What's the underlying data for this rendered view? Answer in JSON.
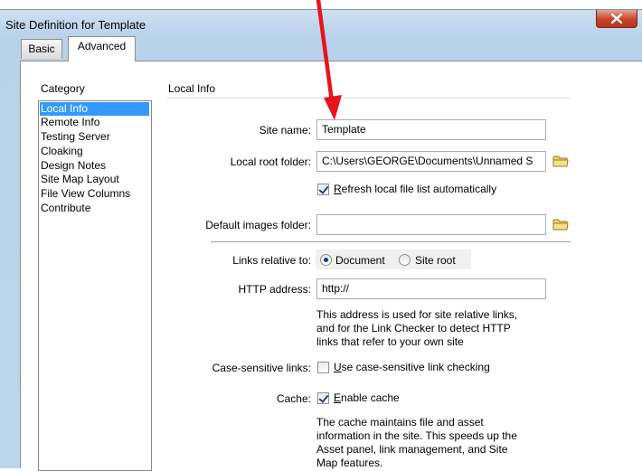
{
  "window": {
    "title": "Site Definition for Template",
    "close_label": "X"
  },
  "tabs": [
    {
      "label": "Basic",
      "active": false
    },
    {
      "label": "Advanced",
      "active": true
    }
  ],
  "category": {
    "heading": "Category",
    "items": [
      "Local Info",
      "Remote Info",
      "Testing Server",
      "Cloaking",
      "Design Notes",
      "Site Map Layout",
      "File View Columns",
      "Contribute"
    ],
    "selected": "Local Info"
  },
  "section_title": "Local Info",
  "form": {
    "site_name": {
      "label": "Site name:",
      "value": "Template"
    },
    "local_root": {
      "label": "Local root folder:",
      "value": "C:\\Users\\GEORGE\\Documents\\Unnamed S"
    },
    "refresh": {
      "accel": "R",
      "rest": "efresh local file list automatically",
      "checked": true
    },
    "default_images": {
      "label": "Default images folder:",
      "value": ""
    },
    "links_relative": {
      "label": "Links relative to:",
      "options": [
        "Document",
        "Site root"
      ],
      "selected": "Document"
    },
    "http_address": {
      "label": "HTTP address:",
      "value": "http://"
    },
    "http_desc": [
      "This address is used for site relative links,",
      "and for the Link Checker to detect HTTP",
      "links that refer to your own site"
    ],
    "case_sensitive": {
      "label": "Case-sensitive links:",
      "accel": "U",
      "rest": "se case-sensitive link checking",
      "checked": false
    },
    "cache": {
      "label": "Cache:",
      "accel": "E",
      "rest": "nable cache",
      "checked": true
    },
    "cache_desc": [
      "The cache maintains file and asset",
      "information in the site.  This speeds up the",
      "Asset panel, link management, and Site",
      "Map features."
    ]
  },
  "colors": {
    "annotation_arrow": "#e8141b",
    "selection": "#3399ff",
    "close_button": "#c7432b"
  },
  "icons": {
    "folder": "folder-icon",
    "arrow": "red-arrow-icon"
  }
}
